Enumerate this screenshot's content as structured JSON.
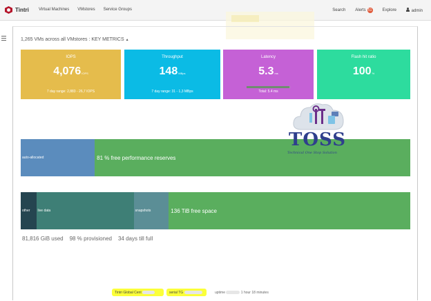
{
  "nav": {
    "brand": "Tintri",
    "items": [
      "Virtual Machines",
      "VMstores",
      "Service Groups"
    ],
    "search": "Search",
    "alerts_label": "Alerts",
    "alerts_count": "51",
    "explore": "Explore",
    "user": "admin"
  },
  "summary": {
    "text": "1,265 VMs across all VMstores : KEY METRICS",
    "caret": "▲"
  },
  "tiles": {
    "iops": {
      "title": "IOPS",
      "value": "4,076",
      "unit": "IOPS",
      "foot": "7 day range: 2,883 - 26,7 IOPS",
      "color": "#e5bc4c"
    },
    "throughput": {
      "title": "Throughput",
      "value": "148",
      "unit": "MBps",
      "foot": "7 day range: 31 - 1,3 MBps",
      "color": "#0bbbe5"
    },
    "latency": {
      "title": "Latency",
      "value": "5.3",
      "unit": "ms",
      "foot": "Total: 5.4 ms",
      "bar_fraction": 0.98,
      "color": "#c561d6"
    },
    "flash": {
      "title": "Flash hit ratio",
      "value": "100",
      "unit": "%",
      "color": "#2ddc9e"
    }
  },
  "performance_bar": {
    "segments": [
      {
        "label": "auto-allocated",
        "fraction": 0.19,
        "color": "#5b8cbd"
      },
      {
        "label": "81 % free performance reserves",
        "fraction": 0.81,
        "color": "#5aae5e"
      }
    ]
  },
  "space_bar": {
    "segments": [
      {
        "label": "other",
        "fraction": 0.04,
        "color": "#254550"
      },
      {
        "label": "live data",
        "fraction": 0.25,
        "color": "#3e7f76"
      },
      {
        "label": "snapshots",
        "fraction": 0.09,
        "color": "#5b8e96"
      },
      {
        "label": "136 TiB free space",
        "fraction": 0.62,
        "color": "#5aae5e"
      }
    ]
  },
  "stats": {
    "used": "81,816 GiB used",
    "provisioned": "98 % provisioned",
    "till_full": "34 days till full"
  },
  "footer": {
    "cert": "Tintri Global Cent",
    "serial": "serial TG",
    "uptime_label": "uptime",
    "uptime_value": "1 hour 18 minutes"
  },
  "watermark": {
    "title": "TOSS",
    "subtitle": "Technical One Stop Solution"
  }
}
